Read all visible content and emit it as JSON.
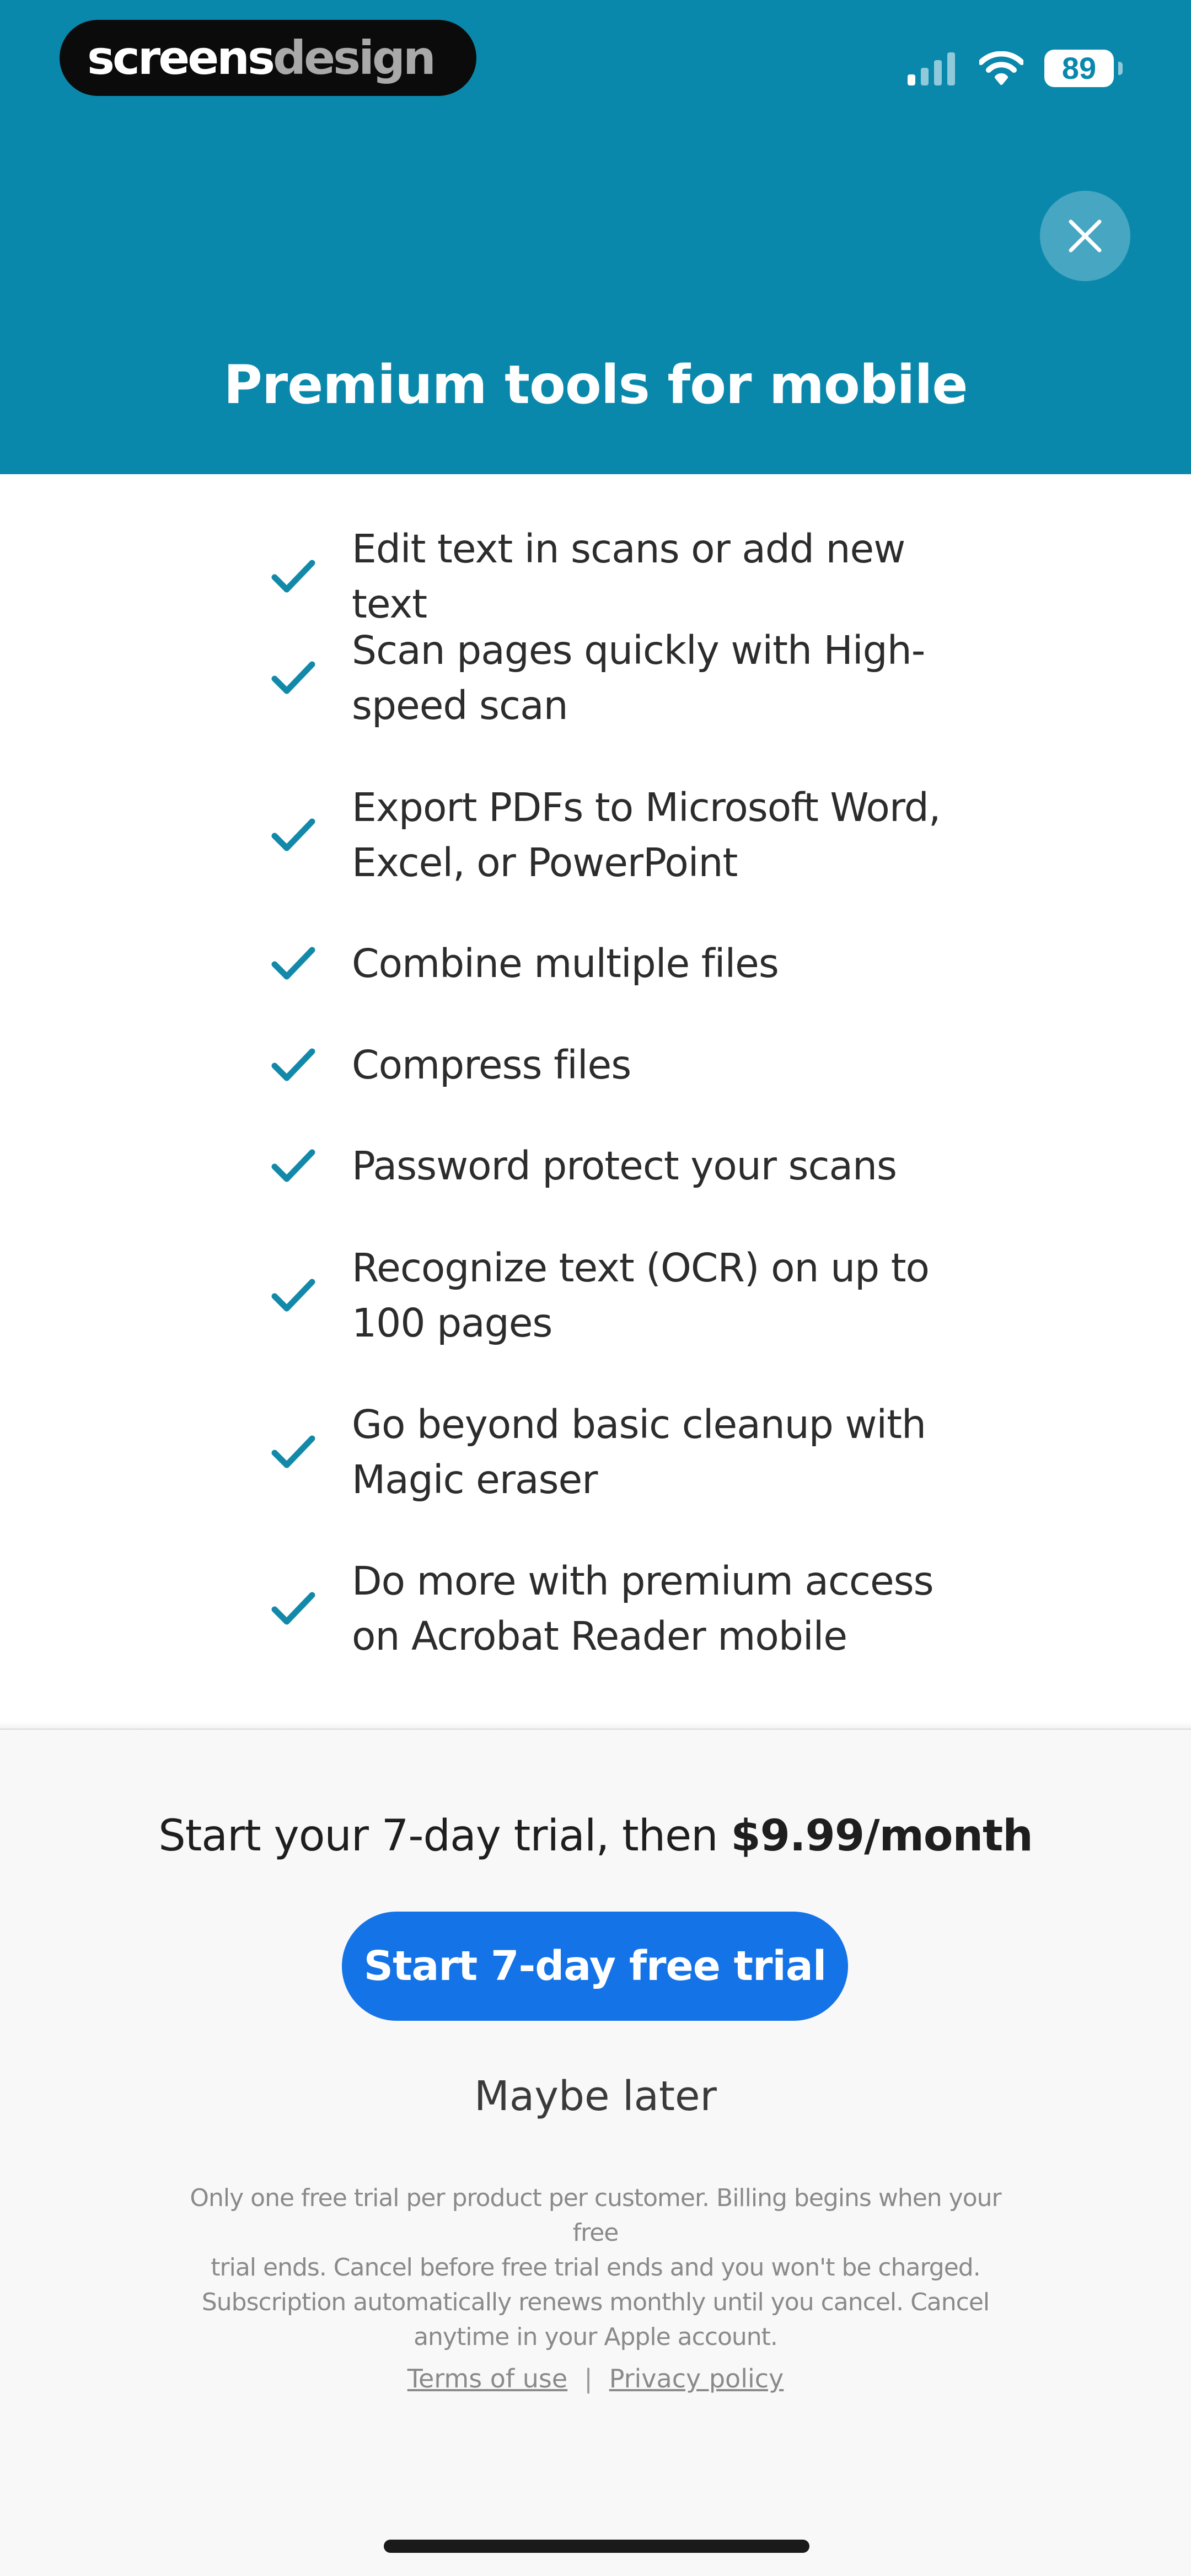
{
  "brand": {
    "logo_part1": "screens",
    "logo_part2": "design"
  },
  "status_bar": {
    "battery_level": "89",
    "signal_icon": "cellular-signal-icon",
    "wifi_icon": "wifi-icon",
    "battery_icon": "battery-icon"
  },
  "header": {
    "title": "Premium tools for mobile",
    "close_icon": "close-icon",
    "background_color": "#0a88ac"
  },
  "features": [
    {
      "line1": "Edit text in scans or add new text",
      "line2": ""
    },
    {
      "line1": "Scan pages quickly with High-",
      "line2": "speed scan"
    },
    {
      "line1": "Export PDFs to Microsoft Word,",
      "line2": "Excel, or PowerPoint"
    },
    {
      "line1": "Combine multiple files",
      "line2": ""
    },
    {
      "line1": "Compress files",
      "line2": ""
    },
    {
      "line1": "Password protect your scans",
      "line2": ""
    },
    {
      "line1": "Recognize text (OCR) on up to",
      "line2": "100 pages"
    },
    {
      "line1": "Go beyond basic cleanup with",
      "line2": "Magic eraser"
    },
    {
      "line1": "Do more with premium access",
      "line2": "on Acrobat Reader mobile"
    }
  ],
  "check_icon": "checkmark-icon",
  "check_color": "#1389aa",
  "offer": {
    "prefix": "Start your 7-day trial, then ",
    "price": "$9.99/month"
  },
  "cta": {
    "label": "Start 7-day free trial",
    "color": "#1473e6"
  },
  "secondary_action": "Maybe later",
  "disclaimer": {
    "line1": "Only one free trial per product per customer. Billing begins when your free",
    "line2": "trial ends. Cancel before free trial ends and you won't be charged.",
    "line3": "Subscription automatically renews monthly until you cancel. Cancel",
    "line4": "anytime in your Apple account."
  },
  "links": {
    "terms": "Terms of use",
    "separator": "|",
    "privacy": "Privacy policy"
  }
}
